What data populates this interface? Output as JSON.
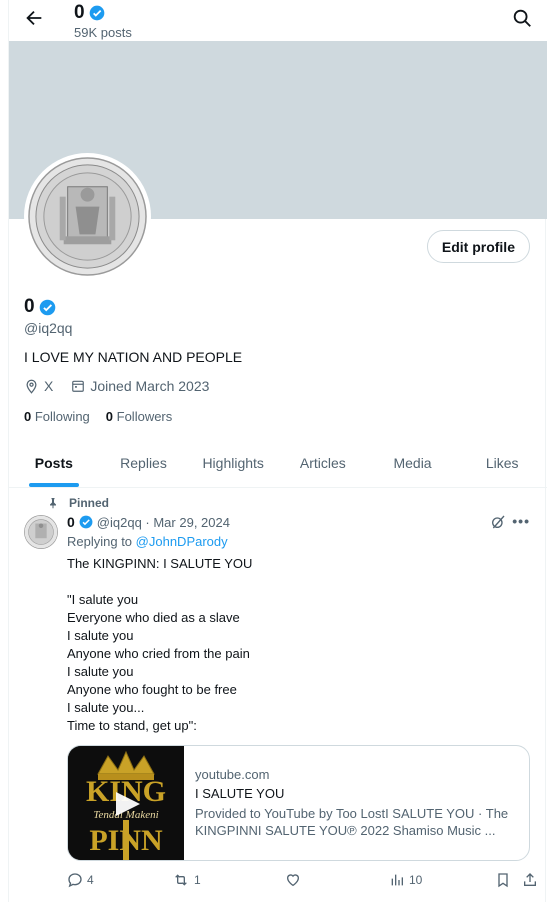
{
  "header": {
    "name": "0",
    "posts": "59K posts"
  },
  "profile": {
    "name": "0",
    "handle": "@iq2qq",
    "bio": "I LOVE MY NATION AND PEOPLE",
    "location": "X",
    "joined": "Joined March 2023",
    "following_count": "0",
    "following_label": "Following",
    "followers_count": "0",
    "followers_label": "Followers",
    "edit_button": "Edit profile"
  },
  "tabs": [
    {
      "label": "Posts",
      "active": true
    },
    {
      "label": "Replies"
    },
    {
      "label": "Highlights"
    },
    {
      "label": "Articles"
    },
    {
      "label": "Media"
    },
    {
      "label": "Likes"
    }
  ],
  "tweet": {
    "pinned_label": "Pinned",
    "author": "0",
    "meta": "@iq2qq · Mar 29, 2024",
    "replying_prefix": "Replying to",
    "replying_to": "@JohnDParody",
    "lines": [
      "The KINGPINN: I SALUTE YOU",
      "",
      "\"I salute you",
      "Everyone who died as a slave",
      "I salute you",
      "Anyone who cried from the pain",
      "I salute you",
      "Anyone who fought to be free",
      "I salute you...",
      "Time to stand, get up\":"
    ],
    "card": {
      "domain": "youtube.com",
      "title": "I SALUTE YOU",
      "description": "Provided to YouTube by Too LostI SALUTE YOU · The KINGPINNI SALUTE YOU℗ 2022 Shamiso Music ...",
      "thumb_text_top": "KING",
      "thumb_text_mid": "Tendai Makeni",
      "thumb_text_bottom": "PINN"
    },
    "actions": {
      "replies": "4",
      "reposts": "1",
      "likes": "",
      "views": "10"
    }
  },
  "colors": {
    "accent": "#1d9bf0",
    "banner": "#cfd9de",
    "secondary_text": "#536471"
  }
}
